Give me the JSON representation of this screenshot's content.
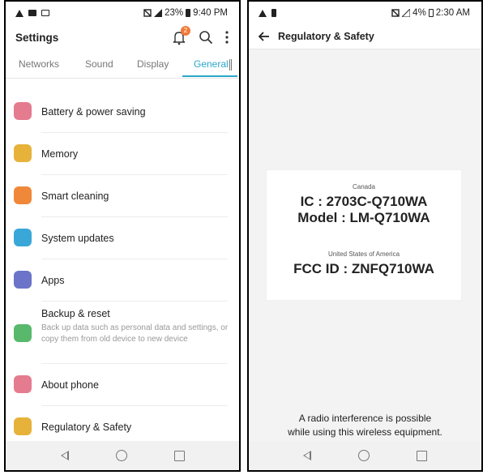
{
  "phone1": {
    "status": {
      "time": "9:40 PM",
      "battery": "23%"
    },
    "header": {
      "title": "Settings",
      "badge_count": "2"
    },
    "tabs": [
      {
        "label": "Networks"
      },
      {
        "label": "Sound"
      },
      {
        "label": "Display"
      },
      {
        "label": "General"
      }
    ],
    "items": [
      {
        "label": "Battery & power saving",
        "color": "#e57b8f"
      },
      {
        "label": "Memory",
        "color": "#e6b23a"
      },
      {
        "label": "Smart cleaning",
        "color": "#f0883a"
      },
      {
        "label": "System updates",
        "color": "#3aa7d9"
      },
      {
        "label": "Apps",
        "color": "#6b74c9"
      },
      {
        "label": "Backup & reset",
        "sub": "Back up data such as personal data and settings, or copy them from old device to new device",
        "color": "#58b86b"
      },
      {
        "label": "About phone",
        "color": "#e57b8f"
      },
      {
        "label": "Regulatory & Safety",
        "color": "#e6b23a"
      }
    ]
  },
  "phone2": {
    "status": {
      "time": "2:30 AM",
      "battery": "4%"
    },
    "header": {
      "title": "Regulatory & Safety"
    },
    "regulatory": {
      "canada_label": "Canada",
      "ic": "IC : 2703C-Q710WA",
      "model": "Model : LM-Q710WA",
      "usa_label": "United States of America",
      "fcc": "FCC ID : ZNFQ710WA"
    },
    "note_line1": "A radio interference is possible",
    "note_line2": "while using this wireless equipment."
  }
}
